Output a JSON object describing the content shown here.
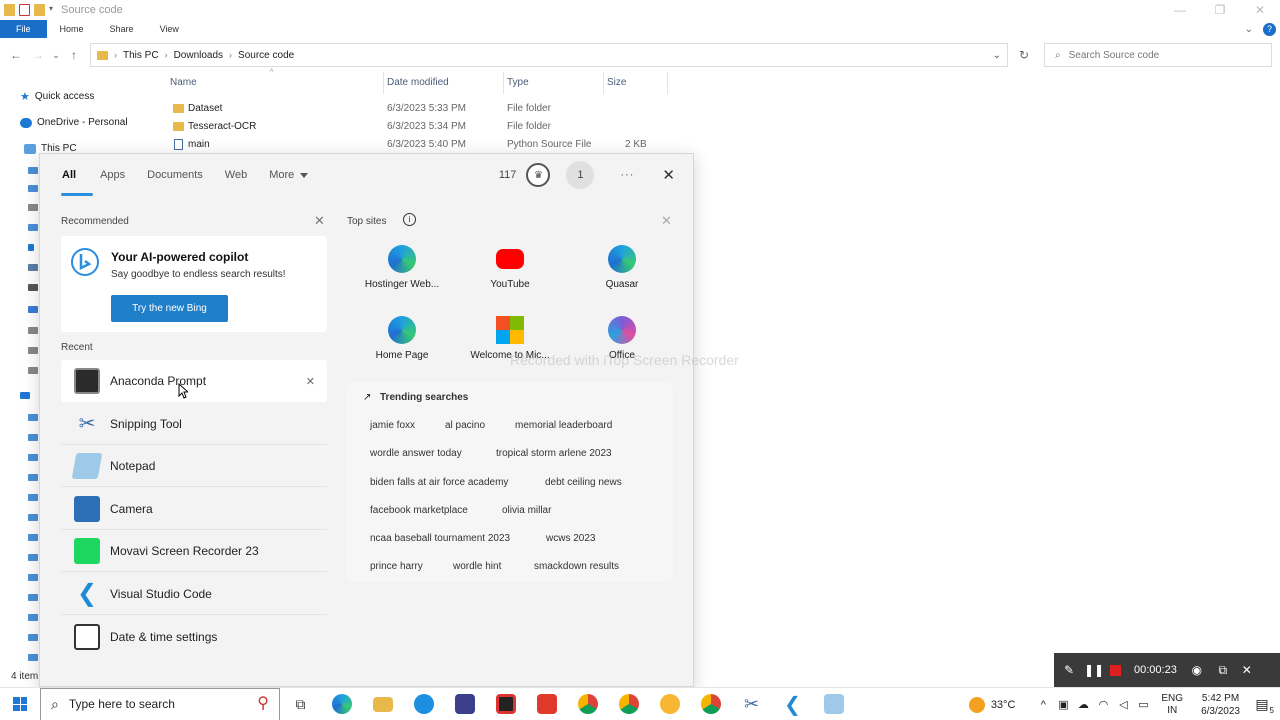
{
  "explorer": {
    "title": "Source code",
    "ribbon_tabs": [
      "File",
      "Home",
      "Share",
      "View"
    ],
    "breadcrumb": [
      "This PC",
      "Downloads",
      "Source code"
    ],
    "search_placeholder": "Search Source code",
    "columns": [
      "Name",
      "Date modified",
      "Type",
      "Size"
    ],
    "files": [
      {
        "name": "Dataset",
        "date": "6/3/2023 5:33 PM",
        "type": "File folder",
        "size": ""
      },
      {
        "name": "Tesseract-OCR",
        "date": "6/3/2023 5:34 PM",
        "type": "File folder",
        "size": ""
      },
      {
        "name": "main",
        "date": "6/3/2023 5:40 PM",
        "type": "Python Source File",
        "size": "2 KB"
      }
    ],
    "nav": {
      "quick_access": "Quick access",
      "onedrive": "OneDrive - Personal",
      "this_pc": "This PC"
    },
    "status": "4 item"
  },
  "flyout": {
    "tabs": [
      "All",
      "Apps",
      "Documents",
      "Web",
      "More"
    ],
    "points": "117",
    "badge_count": "1",
    "recommended": {
      "title": "Recommended",
      "card_title": "Your AI-powered copilot",
      "card_subtitle": "Say goodbye to endless search results!",
      "card_button": "Try the new Bing"
    },
    "recent_title": "Recent",
    "recent": [
      {
        "label": "Anaconda Prompt",
        "icon": "terminal-icon"
      },
      {
        "label": "Snipping Tool",
        "icon": "scissors-icon"
      },
      {
        "label": "Notepad",
        "icon": "notepad-icon"
      },
      {
        "label": "Camera",
        "icon": "camera-icon"
      },
      {
        "label": "Movavi Screen Recorder 23",
        "icon": "recorder-icon"
      },
      {
        "label": "Visual Studio Code",
        "icon": "vscode-icon"
      },
      {
        "label": "Date & time settings",
        "icon": "calendar-icon"
      }
    ],
    "top_sites_title": "Top sites",
    "top_sites": [
      {
        "label": "Hostinger Web...",
        "color": "#1fa0e0"
      },
      {
        "label": "YouTube",
        "color": "#ff0000"
      },
      {
        "label": "Quasar",
        "color": "#1fa0e0"
      },
      {
        "label": "Home Page",
        "color": "#1fa0e0"
      },
      {
        "label": "Welcome to Mic...",
        "color": "#7fba00"
      },
      {
        "label": "Office",
        "color": "#7b5cd6"
      }
    ],
    "trending_title": "Trending searches",
    "trending": [
      "jamie foxx",
      "al pacino",
      "memorial leaderboard",
      "wordle answer today",
      "tropical storm arlene 2023",
      "biden falls at air force academy",
      "debt ceiling news",
      "facebook marketplace",
      "olivia millar",
      "ncaa baseball tournament 2023",
      "wcws 2023",
      "prince harry",
      "wordle hint",
      "smackdown results"
    ]
  },
  "watermark": "Recorded with iTop Screen Recorder",
  "recorder": {
    "time": "00:00:23"
  },
  "taskbar": {
    "search_placeholder": "Type here to search",
    "temperature": "33°C",
    "language": "ENG",
    "region": "IN",
    "time": "5:42 PM",
    "date": "6/3/2023",
    "notifications": "5"
  }
}
